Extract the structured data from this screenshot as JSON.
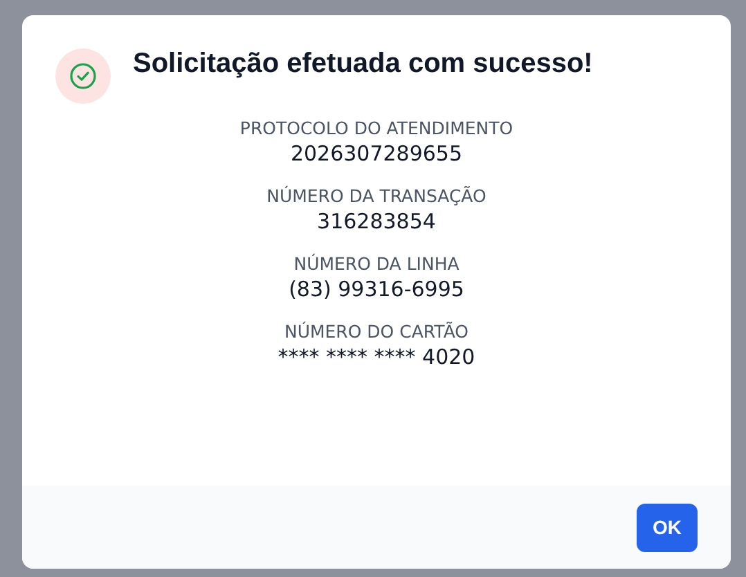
{
  "dialog": {
    "title": "Solicitação efetuada com sucesso!",
    "fields": [
      {
        "label": "PROTOCOLO DO ATENDIMENTO",
        "value": "2026307289655"
      },
      {
        "label": "NÚMERO DA TRANSAÇÃO",
        "value": "316283854"
      },
      {
        "label": "NÚMERO DA LINHA",
        "value": "(83) 99316-6995"
      },
      {
        "label": "NÚMERO DO CARTÃO",
        "value": "**** **** **** 4020"
      }
    ],
    "buttons": [
      "OK"
    ]
  }
}
